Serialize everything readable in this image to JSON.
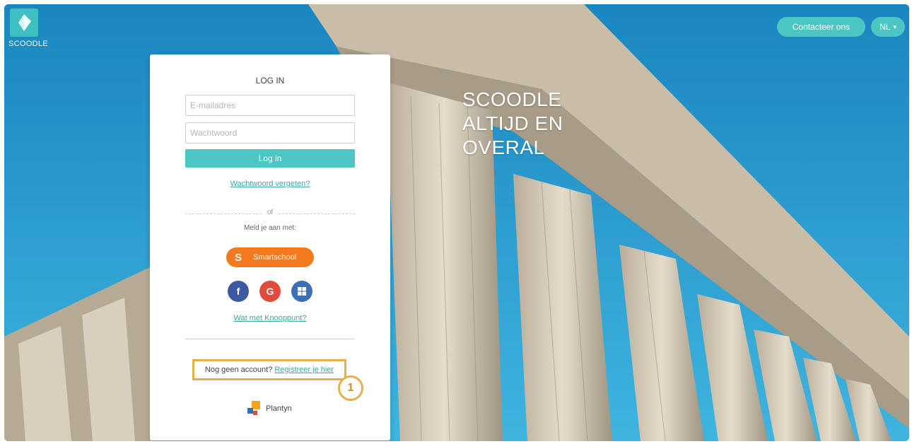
{
  "brand": {
    "logo_text": "SCOODLE"
  },
  "header": {
    "contact_label": "Contacteer ons",
    "language_label": "NL"
  },
  "hero": {
    "lines": [
      "SCOODLE",
      "ALTIJD EN",
      "OVERAL"
    ]
  },
  "login": {
    "title": "LOG IN",
    "email_placeholder": "E-mailadres",
    "password_placeholder": "Wachtwoord",
    "submit_label": "Log in",
    "forgot_link": "Wachtwoord vergeten?",
    "divider_text": "of",
    "social_prompt": "Meld je aan met:",
    "smartschool_letter": "S",
    "smartschool_label": "Smartschool",
    "knooppunt_link": "Wat met Knooppunt?",
    "no_account_text": "Nog geen account?",
    "register_link": "Registreer je hier",
    "marker_number": "1",
    "publisher": "Plantyn"
  },
  "colors": {
    "teal": "#4cc6c3",
    "smartschool_orange": "#f47a1f",
    "facebook": "#3b5aa0",
    "google": "#e04b3c",
    "microsoft": "#3d6fb6",
    "highlight": "#e4b04a"
  },
  "icons": [
    "facebook-icon",
    "google-icon",
    "windows-icon",
    "plantyn-logo-icon",
    "scoodle-logo-icon"
  ]
}
